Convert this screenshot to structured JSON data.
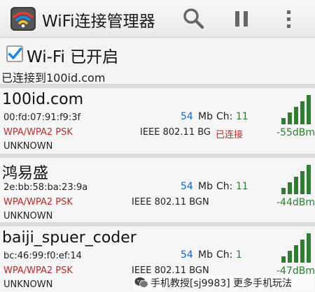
{
  "app": {
    "title": "WiFi连接管理器",
    "icons": {
      "app": "wifi-logo-icon",
      "search": "search-icon",
      "pause": "pause-icon",
      "menu": "overflow-menu-icon"
    }
  },
  "wifi_toggle": {
    "label": "Wi-Fi 已开启",
    "checked": true,
    "status": "已连接到100id.com"
  },
  "networks": [
    {
      "ssid": "100id.com",
      "bssid": "00:fd:07:91:f9:3f",
      "speed": "54",
      "speed_unit": "Mb",
      "channel_label": "Ch:",
      "channel": "11",
      "security": "WPA/WPA2 PSK",
      "standard": "IEEE 802.11 BG",
      "connected_label": "已连接",
      "vendor": "UNKNOWN",
      "signal": "-55dBm",
      "signal_bars": 5
    },
    {
      "ssid": "鸿易盛",
      "bssid": "2e:bb:58:ba:23:9a",
      "speed": "54",
      "speed_unit": "Mb",
      "channel_label": "Ch:",
      "channel": "11",
      "security": "WPA/WPA2 PSK",
      "standard": "IEEE 802.11 BGN",
      "connected_label": "",
      "vendor": "UNKNOWN",
      "signal": "-44dBm",
      "signal_bars": 5
    },
    {
      "ssid": "baiji_spuer_coder",
      "bssid": "bc:46:99:f0:ef:14",
      "speed": "54",
      "speed_unit": "Mb",
      "channel_label": "Ch:",
      "channel": "1",
      "security": "WPA/WPA2 PSK",
      "standard": "IEEE 802.11 BGN",
      "connected_label": "",
      "vendor": "UNKNOWN",
      "signal": "-47dBm",
      "signal_bars": 5
    }
  ],
  "colors": {
    "security": "#c62828",
    "speed": "#1565c0",
    "signal": "#2e7d32",
    "checkbox": "#1e88e5"
  },
  "watermark": {
    "text": "手机教授[sj9983] 更多手机玩法",
    "icon": "wechat-icon"
  }
}
